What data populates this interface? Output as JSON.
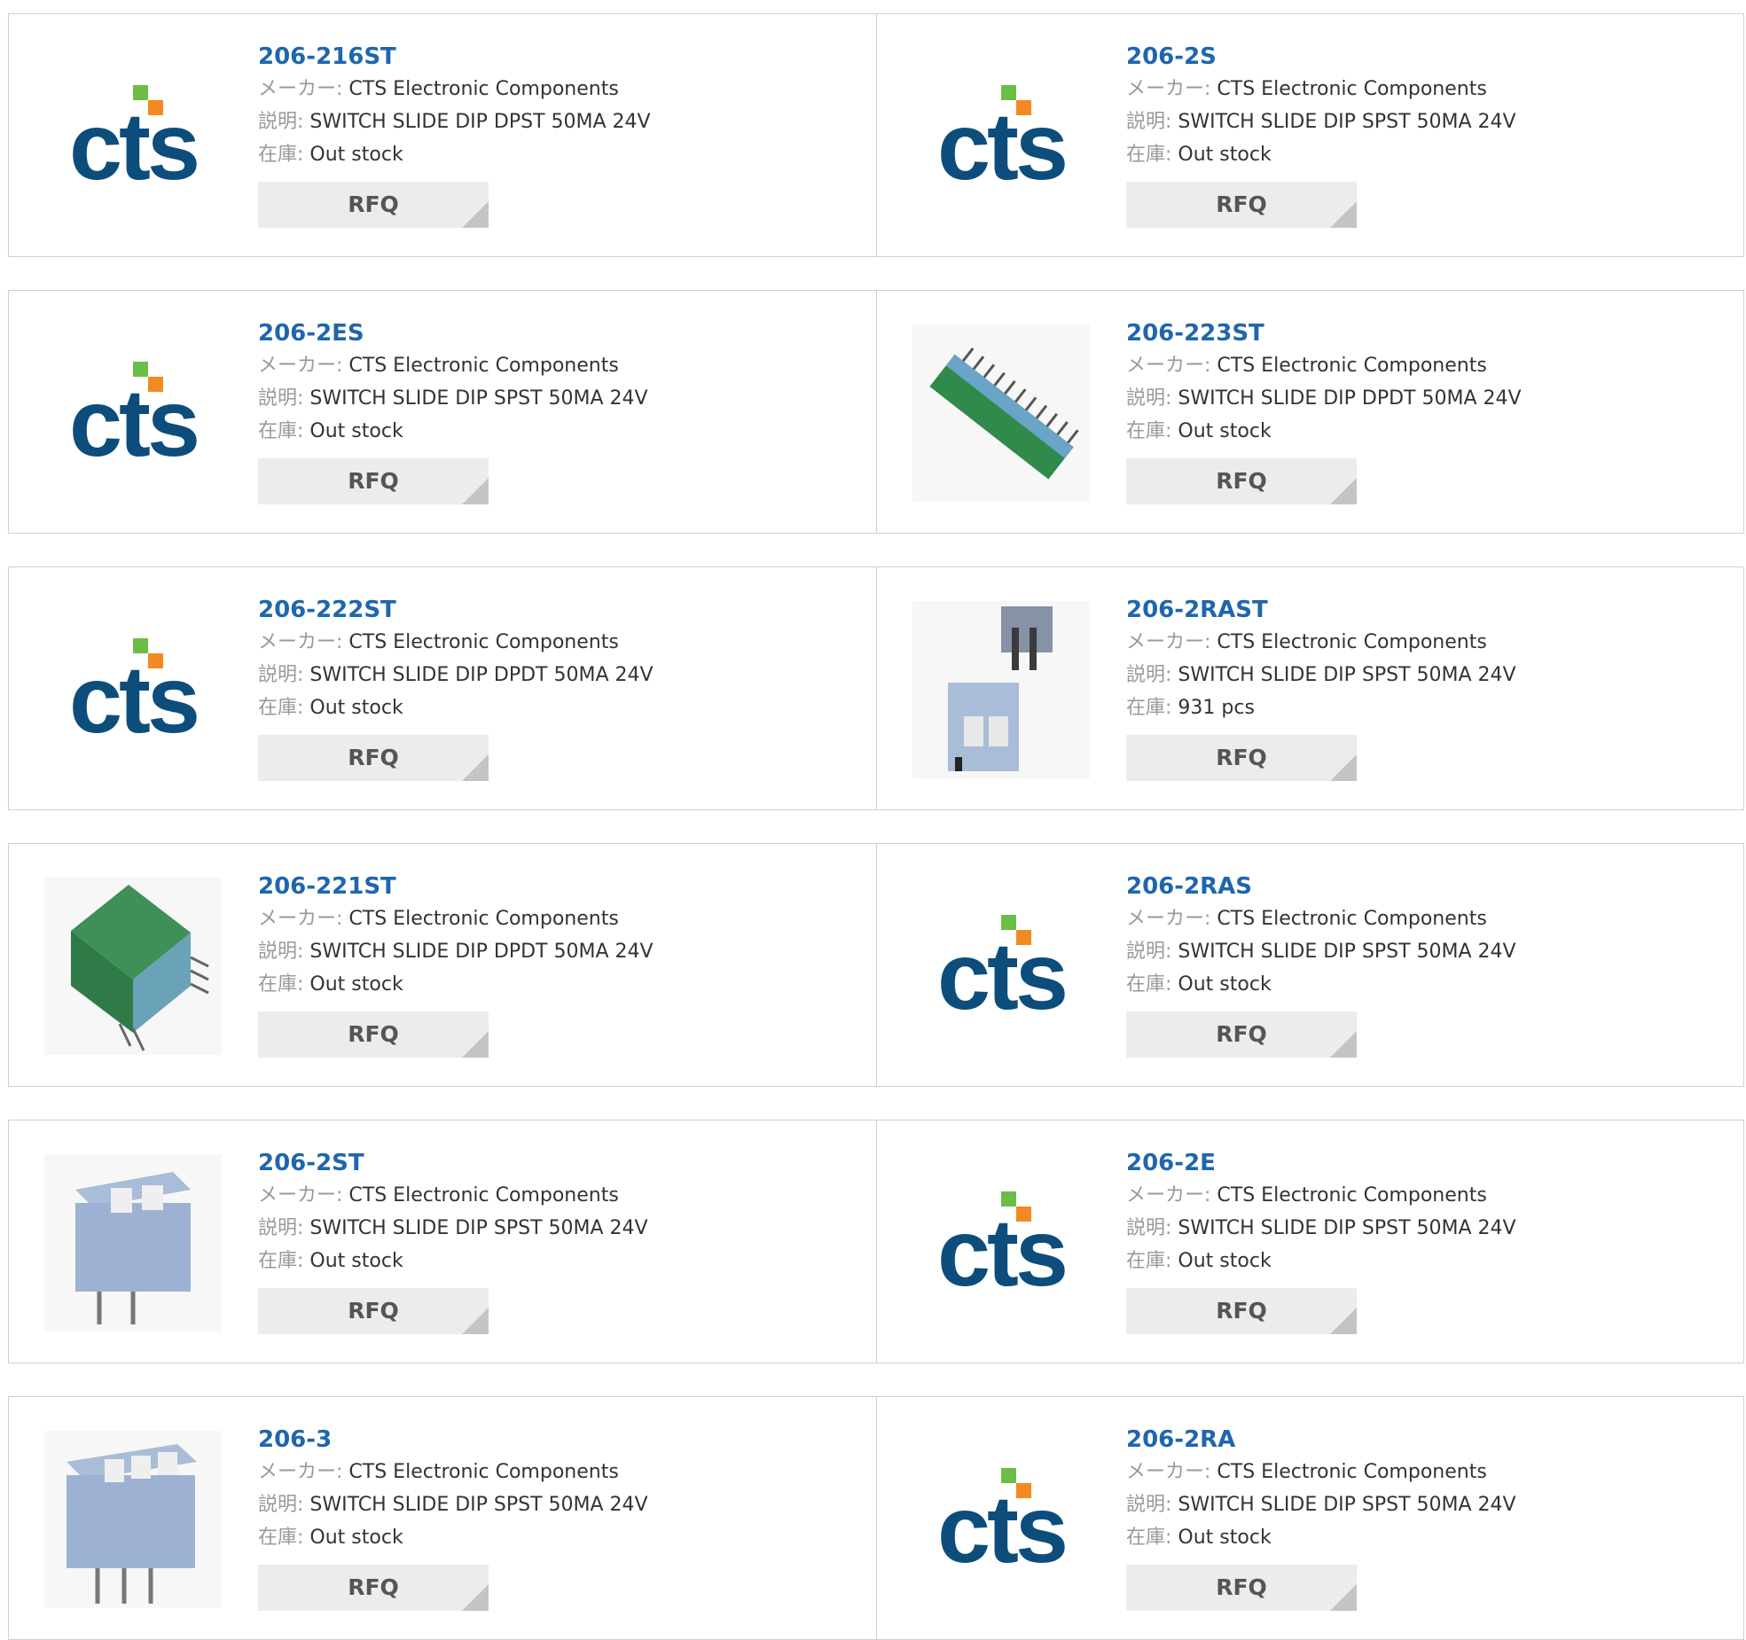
{
  "labels": {
    "maker": "メーカー:",
    "desc": "説明:",
    "stock": "在庫:",
    "rfq": "RFQ"
  },
  "colors": {
    "link": "#1f66ad",
    "rfq_bg": "#ececec",
    "border": "#cfcfcf"
  },
  "products": [
    {
      "pn": "206-216ST",
      "maker": "CTS Electronic Components",
      "desc": "SWITCH SLIDE DIP DPST 50MA 24V",
      "stock": "Out stock",
      "image": "cts-logo"
    },
    {
      "pn": "206-2S",
      "maker": "CTS Electronic Components",
      "desc": "SWITCH SLIDE DIP SPST 50MA 24V",
      "stock": "Out stock",
      "image": "cts-logo"
    },
    {
      "pn": "206-2ES",
      "maker": "CTS Electronic Components",
      "desc": "SWITCH SLIDE DIP SPST 50MA 24V",
      "stock": "Out stock",
      "image": "cts-logo"
    },
    {
      "pn": "206-223ST",
      "maker": "CTS Electronic Components",
      "desc": "SWITCH SLIDE DIP DPDT 50MA 24V",
      "stock": "Out stock",
      "image": "green-dip-switch-long"
    },
    {
      "pn": "206-222ST",
      "maker": "CTS Electronic Components",
      "desc": "SWITCH SLIDE DIP DPDT 50MA 24V",
      "stock": "Out stock",
      "image": "cts-logo"
    },
    {
      "pn": "206-2RAST",
      "maker": "CTS Electronic Components",
      "desc": "SWITCH SLIDE DIP SPST 50MA 24V",
      "stock": "931 pcs",
      "image": "blue-dip-switch-pair"
    },
    {
      "pn": "206-221ST",
      "maker": "CTS Electronic Components",
      "desc": "SWITCH SLIDE DIP DPDT 50MA 24V",
      "stock": "Out stock",
      "image": "green-dip-switch-cube"
    },
    {
      "pn": "206-2RAS",
      "maker": "CTS Electronic Components",
      "desc": "SWITCH SLIDE DIP SPST 50MA 24V",
      "stock": "Out stock",
      "image": "cts-logo"
    },
    {
      "pn": "206-2ST",
      "maker": "CTS Electronic Components",
      "desc": "SWITCH SLIDE DIP SPST 50MA 24V",
      "stock": "Out stock",
      "image": "blue-dip-switch-2pos"
    },
    {
      "pn": "206-2E",
      "maker": "CTS Electronic Components",
      "desc": "SWITCH SLIDE DIP SPST 50MA 24V",
      "stock": "Out stock",
      "image": "cts-logo"
    },
    {
      "pn": "206-3",
      "maker": "CTS Electronic Components",
      "desc": "SWITCH SLIDE DIP SPST 50MA 24V",
      "stock": "Out stock",
      "image": "blue-dip-switch-3pos"
    },
    {
      "pn": "206-2RA",
      "maker": "CTS Electronic Components",
      "desc": "SWITCH SLIDE DIP SPST 50MA 24V",
      "stock": "Out stock",
      "image": "cts-logo"
    }
  ]
}
